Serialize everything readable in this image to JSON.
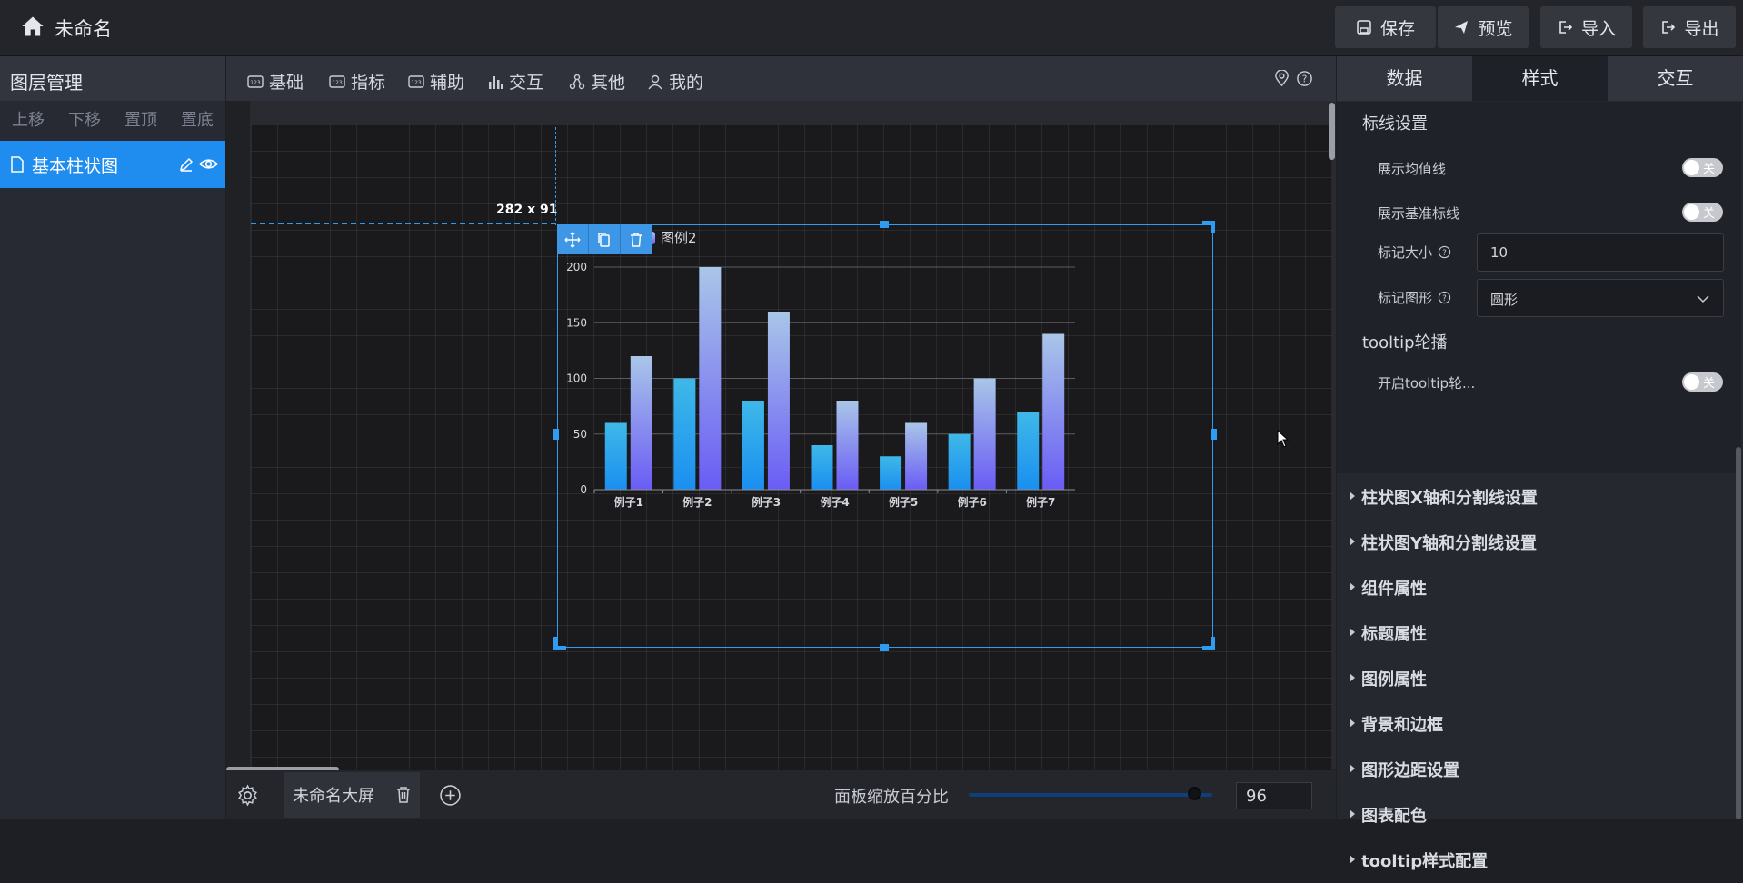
{
  "app": {
    "title": "未命名",
    "buttons": [
      {
        "label": "保存",
        "icon": "save-icon"
      },
      {
        "label": "预览",
        "icon": "send-icon"
      },
      {
        "label": "导入",
        "icon": "import-icon"
      },
      {
        "label": "导出",
        "icon": "export-icon"
      }
    ]
  },
  "layers": {
    "title": "图层管理",
    "actions": [
      "上移",
      "下移",
      "置顶",
      "置底"
    ],
    "items": [
      {
        "label": "基本柱状图"
      }
    ]
  },
  "toolbar": {
    "items": [
      {
        "label": "基础",
        "icon": "component-icon"
      },
      {
        "label": "指标",
        "icon": "component-icon"
      },
      {
        "label": "辅助",
        "icon": "component-icon"
      },
      {
        "label": "交互",
        "icon": "bar-chart-icon"
      },
      {
        "label": "其他",
        "icon": "nodes-icon"
      },
      {
        "label": "我的",
        "icon": "user-icon"
      }
    ]
  },
  "canvas": {
    "size_label": "282 x 91"
  },
  "bottom": {
    "screen_name": "未命名大屏",
    "zoom_label": "面板缩放百分比",
    "zoom_value": "96",
    "zoom_fraction": 0.96
  },
  "right": {
    "tabs": [
      "数据",
      "样式",
      "交互"
    ],
    "active_tab": "样式",
    "markline_heading": "标线设置",
    "show_avg": "展示均值线",
    "show_base": "展示基准标线",
    "mark_size_label": "标记大小",
    "mark_size_value": "10",
    "mark_shape_label": "标记图形",
    "mark_shape_value": "圆形",
    "tooltip_heading": "tooltip轮播",
    "tooltip_toggle_label": "开启tooltip轮...",
    "toggle_off": "关",
    "sections": [
      "柱状图X轴和分割线设置",
      "柱状图Y轴和分割线设置",
      "组件属性",
      "标题属性",
      "图例属性",
      "背景和边框",
      "图形边距设置",
      "图表配色",
      "tooltip样式配置"
    ]
  },
  "chart_data": {
    "type": "bar",
    "categories": [
      "例子1",
      "例子2",
      "例子3",
      "例子4",
      "例子5",
      "例子6",
      "例子7"
    ],
    "series": [
      {
        "name": "",
        "values": [
          60,
          100,
          80,
          40,
          30,
          50,
          70
        ],
        "color": "#1ea3f0"
      },
      {
        "name": "图例2",
        "values": [
          120,
          200,
          160,
          80,
          60,
          100,
          140
        ],
        "color": "#7a6cf2"
      }
    ],
    "ylim": [
      0,
      200
    ],
    "yticks": [
      0,
      50,
      100,
      150,
      200
    ],
    "grid": true,
    "legend": "top"
  }
}
